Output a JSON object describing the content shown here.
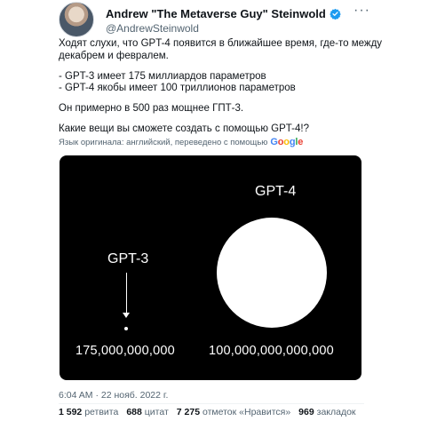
{
  "author": {
    "name": "Andrew \"The Metaverse Guy\" Steinwold",
    "handle": "@AndrewSteinwold",
    "more": "···"
  },
  "tweet": {
    "lines": [
      "Ходят слухи, что GPT-4 появится в ближайшее время, где-то между",
      "декабрем и февралем.",
      "- GPT-3 имеет 175 миллиардов параметров",
      "- GPT-4 якобы имеет 100 триллионов параметров",
      "Он примерно в 500 раз мощнее ГПТ-3.",
      "Какие вещи вы сможете создать с помощью GPT-4!?"
    ],
    "translated_note": "Язык оригинала: английский, переведено с помощью",
    "google_logo": "Google"
  },
  "image": {
    "gpt4_label": "GPT-4",
    "gpt3_label": "GPT-3",
    "gpt3_value": "175,000,000,000",
    "gpt4_value": "100,000,000,000,000"
  },
  "meta": {
    "timestamp": "6:04 AM · 22 нояб. 2022 г."
  },
  "stats": {
    "retweets_count": "1 592",
    "retweets_label": "ретвита",
    "quotes_count": "688",
    "quotes_label": "цитат",
    "likes_count": "7 275",
    "likes_label": "отметок «Нравится»",
    "bookmarks_count": "969",
    "bookmarks_label": "закладок"
  },
  "colors": {
    "verified": "#1d9bf0",
    "secondary_text": "#536471",
    "media_bg": "#000000"
  }
}
